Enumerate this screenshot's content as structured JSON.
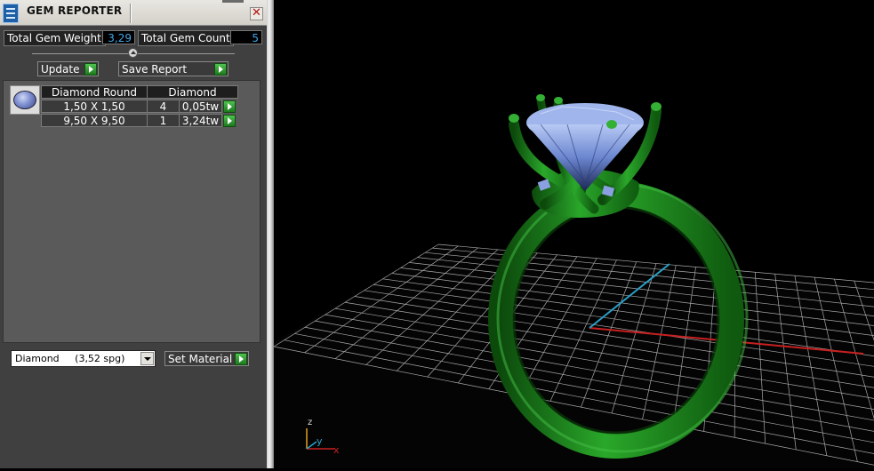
{
  "panel": {
    "title": "GEM REPORTER",
    "stats": {
      "weight_label": "Total Gem Weight",
      "weight_value": "3,29",
      "count_label": "Total Gem Count",
      "count_value": "5"
    },
    "buttons": {
      "update": "Update",
      "save_report": "Save Report",
      "set_material": "Set Material"
    },
    "table": {
      "columns": [
        "Diamond Round",
        "Diamond"
      ],
      "rows": [
        {
          "size": "1,50 X 1,50",
          "count": "4",
          "weight": "0,05tw"
        },
        {
          "size": "9,50 X 9,50",
          "count": "1",
          "weight": "3,24tw"
        }
      ]
    },
    "material": {
      "selected": "Diamond     (3,52 spg)"
    }
  },
  "viewport": {
    "axis_labels": {
      "z": "z",
      "y": "y",
      "x": "x"
    }
  },
  "colors": {
    "panel_bg": "#404040",
    "value_text": "#3fa6e8",
    "metal": "#1f8a1f",
    "gem": "#7f9be0",
    "grid": "#d0d0d0"
  },
  "icons": [
    "gem-reporter-app-icon",
    "close-icon",
    "play-arrow-icon",
    "dropdown-arrow-icon",
    "gem-round-icon",
    "slider-knob-icon"
  ]
}
